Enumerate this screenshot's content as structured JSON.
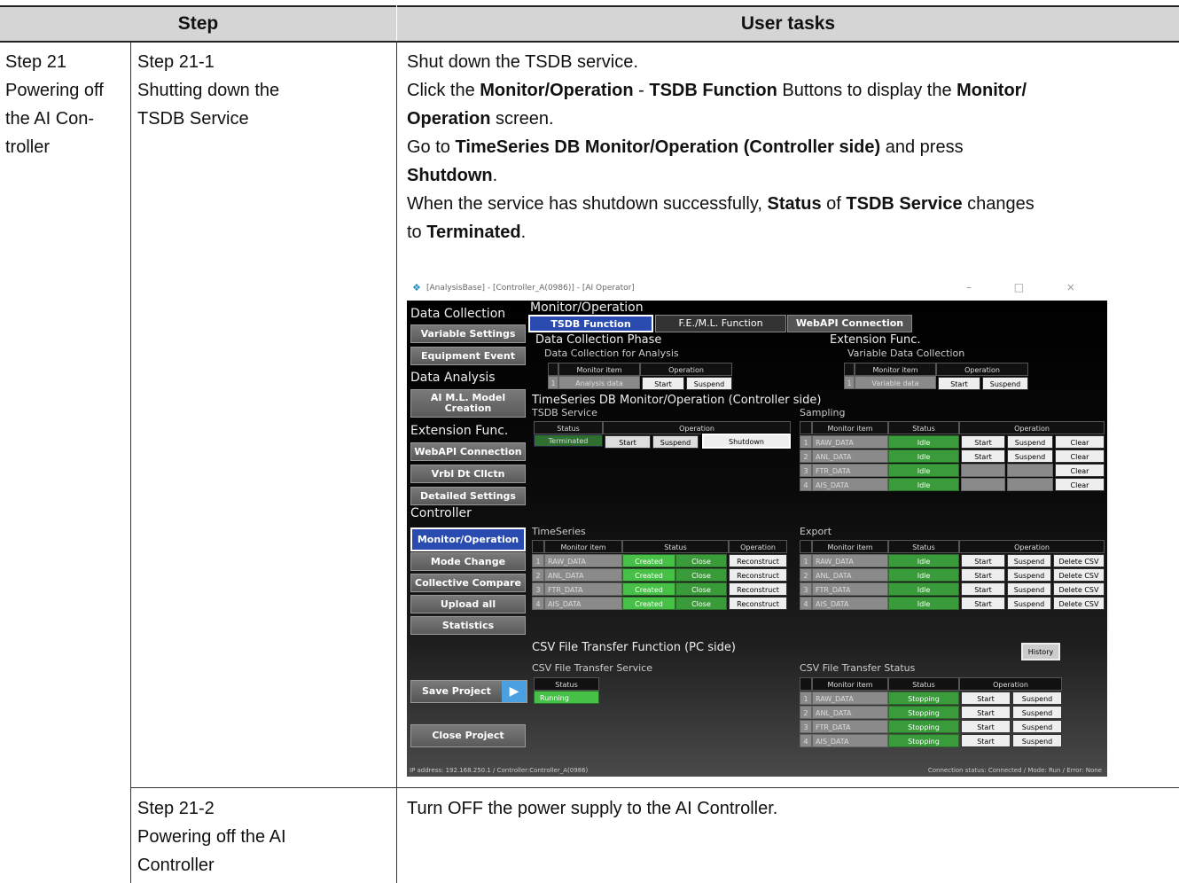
{
  "header": {
    "step": "Step",
    "user_tasks": "User tasks"
  },
  "row1": {
    "step_main": [
      "Step 21",
      "Powering off",
      "the AI Con-",
      "troller"
    ],
    "step_sub": [
      "Step 21-1",
      "Shutting down the",
      "TSDB Service"
    ],
    "task": {
      "l1": "Shut down the TSDB service.",
      "l2a": "Click the ",
      "l2b": "Monitor/Operation",
      "l2c": " - ",
      "l2d": "TSDB Function",
      "l2e": " Buttons to display the ",
      "l2f": "Monitor/",
      "l3a": "Operation",
      "l3b": " screen.",
      "l4a": "Go to ",
      "l4b": "TimeSeries DB Monitor/Operation (Controller side)",
      "l4c": " and press",
      "l5a": "Shutdown",
      "l5b": ".",
      "l6a": "When the service has shutdown successfully, ",
      "l6b": "Status",
      "l6c": " of ",
      "l6d": "TSDB Service",
      "l6e": " changes",
      "l7a": "to ",
      "l7b": "Terminated",
      "l7c": "."
    }
  },
  "row2": {
    "step_sub": [
      "Step 21-2",
      "Powering off the AI",
      "Controller"
    ],
    "task": "Turn OFF the power supply to the AI Controller."
  },
  "app": {
    "title": "[AnalysisBase] - [Controller_A(0986)] - [AI Operator]",
    "win_buttons": "– □ ×",
    "sidebar": {
      "data_collection": "Data Collection",
      "variable_settings": "Variable Settings",
      "equipment_event": "Equipment Event",
      "data_analysis": "Data Analysis",
      "ai_ml_1": "AI M.L. Model",
      "ai_ml_2": "Creation",
      "extension_func": "Extension Func.",
      "webapi_connection": "WebAPI Connection",
      "vrbl": "Vrbl Dt Cllctn",
      "detailed_settings": "Detailed Settings",
      "controller": "Controller",
      "monitor_operation": "Monitor/Operation",
      "mode_change": "Mode Change",
      "collective_compare": "Collective Compare",
      "upload_all": "Upload all",
      "statistics": "Statistics",
      "save_project": "Save Project",
      "close_project": "Close Project"
    },
    "main": {
      "page_title": "Monitor/Operation",
      "tabs": [
        "TSDB Function",
        "F.E./M.L. Function",
        "WebAPI Connection"
      ],
      "dcp": "Data Collection Phase",
      "dca": "Data Collection for Analysis",
      "ext": "Extension Func.",
      "vdc": "Variable Data Collection",
      "monitor_item": "Monitor item",
      "operation": "Operation",
      "status": "Status",
      "analysis_data": "Analysis data",
      "variable_data": "Variable data",
      "start": "Start",
      "suspend": "Suspend",
      "shutdown": "Shutdown",
      "clear": "Clear",
      "close": "Close",
      "reconstruct": "Reconstruct",
      "delete_csv": "Delete CSV",
      "tsdb_section": "TimeSeries DB Monitor/Operation (Controller side)",
      "tsdb_service": "TSDB Service",
      "terminated": "Terminated",
      "sampling": "Sampling",
      "timeseries": "TimeSeries",
      "export": "Export",
      "idle": "Idle",
      "created": "Created",
      "stopping": "Stopping",
      "running": "Running",
      "items": [
        "RAW_DATA",
        "ANL_DATA",
        "FTR_DATA",
        "AIS_DATA"
      ],
      "nums": [
        "1",
        "2",
        "3",
        "4"
      ],
      "csv_section": "CSV File Transfer Function (PC side)",
      "csv_service": "CSV File Transfer Service",
      "csv_status": "CSV File Transfer Status",
      "history": "History"
    },
    "status_left": "IP address: 192.168.250.1 / Controller:Controller_A(0986)",
    "status_right": "Connection status: Connected / Mode: Run / Error: None"
  }
}
